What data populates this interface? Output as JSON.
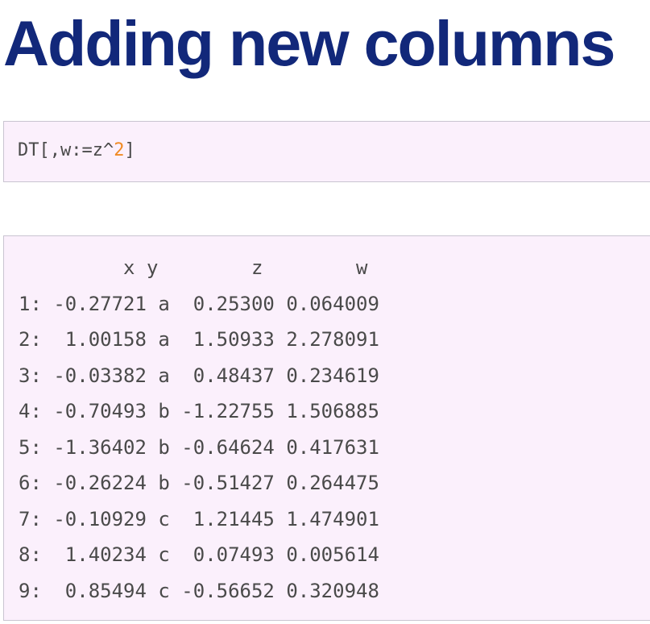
{
  "slide": {
    "title": "Adding new columns"
  },
  "code": {
    "prefix": "DT[,w:=z^",
    "number": "2",
    "suffix": "]"
  },
  "output": {
    "header": "         x y        z        w",
    "rows": [
      "1: -0.27721 a  0.25300 0.064009",
      "2:  1.00158 a  1.50933 2.278091",
      "3: -0.03382 a  0.48437 0.234619",
      "4: -0.70493 b -1.22755 1.506885",
      "5: -1.36402 b -0.64624 0.417631",
      "6: -0.26224 b -0.51427 0.264475",
      "7: -0.10929 c  1.21445 1.474901",
      "8:  1.40234 c  0.07493 0.005614",
      "9:  0.85494 c -0.56652 0.320948"
    ]
  },
  "colors": {
    "title": "#12287a",
    "code_background": "#fbf0fc",
    "border": "#c9c5d1",
    "code_text": "#4a4a4a",
    "number_literal": "#f08a24"
  }
}
